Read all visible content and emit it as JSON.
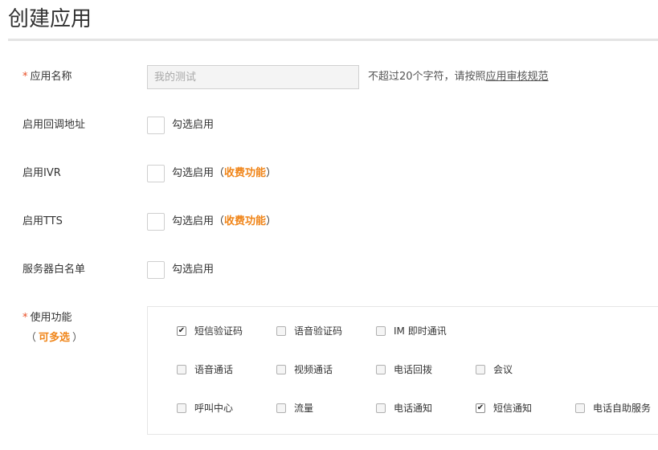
{
  "page": {
    "title": "创建应用"
  },
  "form": {
    "app_name": {
      "label": "应用名称",
      "required_mark": "*",
      "placeholder": "我的测试",
      "hint_prefix": "不超过20个字符，请按照",
      "hint_link": "应用审核规范"
    },
    "callback": {
      "label": "启用回调地址",
      "check_text": "勾选启用"
    },
    "ivr": {
      "label": "启用IVR",
      "check_text": "勾选启用",
      "open_paren": "（",
      "fee_text": "收费功能",
      "close_paren": "）"
    },
    "tts": {
      "label": "启用TTS",
      "check_text": "勾选启用",
      "open_paren": "（",
      "fee_text": "收费功能",
      "close_paren": "）"
    },
    "whitelist": {
      "label": "服务器白名单",
      "check_text": "勾选启用"
    },
    "features": {
      "label": "使用功能",
      "required_mark": "*",
      "multi_open": "（",
      "multi_text": "可多选",
      "multi_close": "）",
      "options": [
        {
          "label": "短信验证码",
          "checked": true
        },
        {
          "label": "语音验证码",
          "checked": false
        },
        {
          "label": "IM 即时通讯",
          "checked": false
        },
        {
          "label": "语音通话",
          "checked": false
        },
        {
          "label": "视频通话",
          "checked": false
        },
        {
          "label": "电话回拨",
          "checked": false
        },
        {
          "label": "会议",
          "checked": false
        },
        {
          "label": "呼叫中心",
          "checked": false
        },
        {
          "label": "流量",
          "checked": false
        },
        {
          "label": "电话通知",
          "checked": false
        },
        {
          "label": "短信通知",
          "checked": true
        },
        {
          "label": "电话自助服务",
          "checked": false
        }
      ]
    }
  },
  "colors": {
    "accent": "#f08519",
    "required": "#e94e24"
  }
}
